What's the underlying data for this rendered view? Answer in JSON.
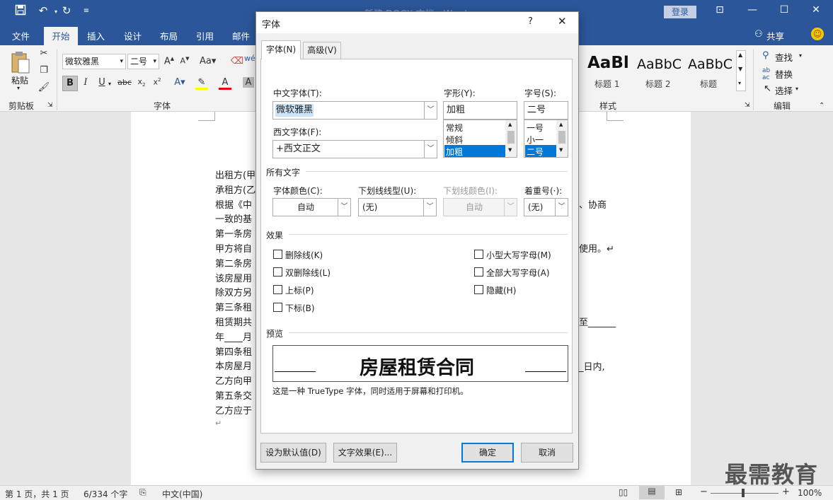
{
  "titlebar": {
    "doc_title": "新建 DOCX 文档 - Word",
    "login": "登录"
  },
  "tabs": [
    "文件",
    "开始",
    "插入",
    "设计",
    "布局",
    "引用",
    "邮件"
  ],
  "share_label": "共享",
  "ribbon": {
    "font_name": "微软雅黑",
    "font_size": "二号",
    "paste_label": "粘贴",
    "clipboard_label": "剪贴板",
    "font_group_label": "字体",
    "styles_label": "样式",
    "edit_label": "编辑",
    "styles": [
      {
        "preview": "AaBl",
        "name": "标题 1"
      },
      {
        "preview": "AaBbC",
        "name": "标题 2"
      },
      {
        "preview": "AaBbC",
        "name": "标题"
      }
    ],
    "find_label": "查找",
    "replace_label": "替换",
    "select_label": "选择"
  },
  "document": {
    "left_lines": [
      "出租方(甲",
      "承租方(乙",
      "根据《中",
      "一致的基",
      "第一条房",
      "甲方将自",
      "第二条房",
      "该房屋用",
      "除双方另",
      "第三条租",
      "租赁期共",
      "年____月",
      "第四条租",
      "本房屋月",
      "乙方向甲",
      "第五条交",
      "乙方应于"
    ],
    "right_fragments": [
      {
        "text": "、协商"
      },
      {
        "text": "使用。↵"
      },
      {
        "text": "至______"
      },
      {
        "text": "_日内,"
      }
    ]
  },
  "statusbar": {
    "page": "第 1 页，共 1 页",
    "words": "6/334 个字",
    "lang": "中文(中国)",
    "zoom": "100%"
  },
  "watermark": "最需教育",
  "dialog": {
    "title": "字体",
    "help": "?",
    "tabs": [
      "字体(N)",
      "高级(V)"
    ],
    "cn_font_label": "中文字体(T):",
    "cn_font_value": "微软雅黑",
    "west_font_label": "西文字体(F):",
    "west_font_value": "+西文正文",
    "style_label": "字形(Y):",
    "style_value": "加粗",
    "style_options": [
      "常规",
      "倾斜",
      "加粗"
    ],
    "size_label": "字号(S):",
    "size_value": "二号",
    "size_options": [
      "一号",
      "小一",
      "二号"
    ],
    "all_text_label": "所有文字",
    "color_label": "字体颜色(C):",
    "color_value": "自动",
    "underline_label": "下划线线型(U):",
    "underline_value": "(无)",
    "underline_color_label": "下划线颜色(I):",
    "underline_color_value": "自动",
    "emphasis_label": "着重号(·):",
    "emphasis_value": "(无)",
    "effects_label": "效果",
    "effects_left": [
      "删除线(K)",
      "双删除线(L)",
      "上标(P)",
      "下标(B)"
    ],
    "effects_right": [
      "小型大写字母(M)",
      "全部大写字母(A)",
      "隐藏(H)"
    ],
    "preview_label": "预览",
    "preview_text": "房屋租赁合同",
    "preview_note": "这是一种 TrueType 字体，同时适用于屏幕和打印机。",
    "default_btn": "设为默认值(D)",
    "effects_btn": "文字效果(E)...",
    "ok_btn": "确定",
    "cancel_btn": "取消"
  }
}
